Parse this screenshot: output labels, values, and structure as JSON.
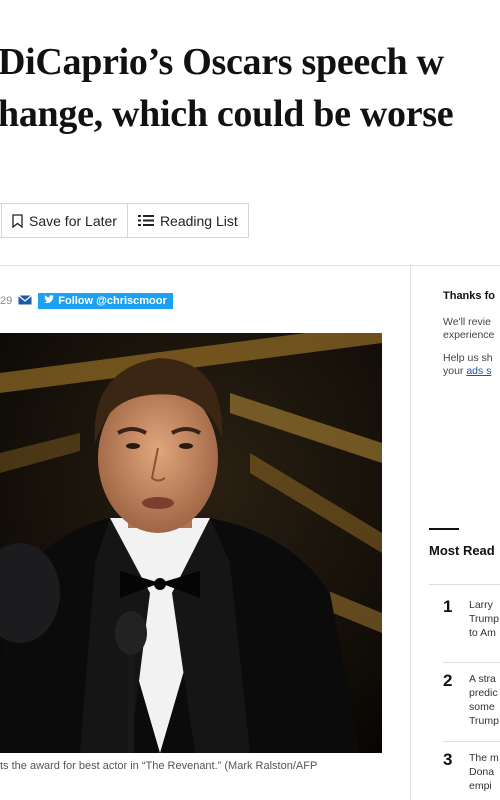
{
  "article": {
    "headline_line1": "DiCaprio’s Oscars speech w",
    "headline_line2": "hange, which could be worse"
  },
  "toolbar": {
    "save_label": "Save for Later",
    "reading_list_label": "Reading List"
  },
  "byline": {
    "time_fragment": "29",
    "follow_label": "Follow @chriscmoor"
  },
  "photo": {
    "caption": "ts the award for best actor in “The Revenant.” (Mark Ralston/AFP"
  },
  "sidebar": {
    "feedback_heading": "Thanks fo",
    "feedback_line1": "We'll revie",
    "feedback_line2": "experience",
    "help_line1": "Help us sh",
    "help_line2_prefix": "your ",
    "help_line2_link": "ads s"
  },
  "most_read": {
    "title": "Most Read",
    "items": [
      {
        "num": "1",
        "lines": [
          "Larry",
          "Trump",
          "to Am"
        ]
      },
      {
        "num": "2",
        "lines": [
          "A stra",
          "predic",
          "some",
          "Trump"
        ]
      },
      {
        "num": "3",
        "lines": [
          "The m",
          "Dona",
          "empi"
        ]
      }
    ]
  },
  "colors": {
    "accent": "#1da1f2",
    "link": "#1955a5",
    "rule": "#e1e1e1"
  },
  "icons": [
    "bookmark-icon",
    "list-icon",
    "mail-icon",
    "twitter-bird-icon"
  ]
}
